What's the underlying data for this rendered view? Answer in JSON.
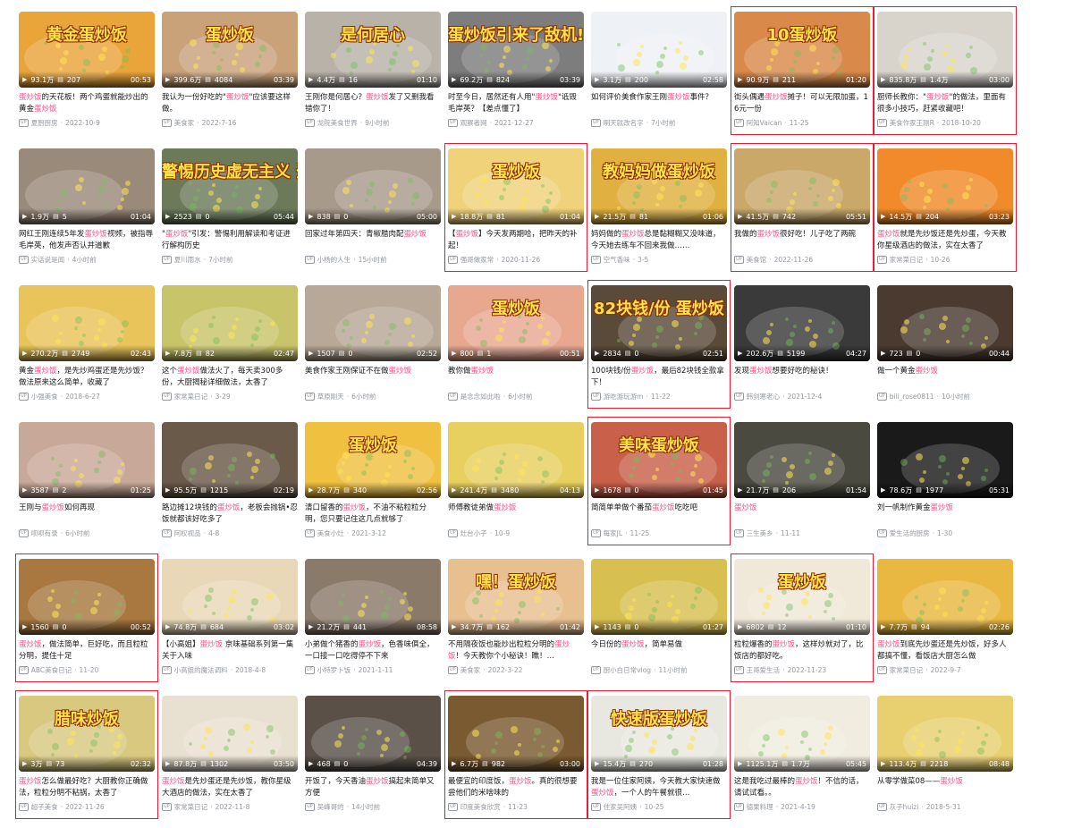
{
  "keyword": "蛋炒饭",
  "colors": {
    "highlight": "#ff4f8b",
    "box": "#e0203a"
  },
  "videos": [
    {
      "overlay": "黄金蛋炒饭",
      "views": "93.1万",
      "danmaku": "207",
      "duration": "00:53",
      "title": "蛋炒饭的天花板！两个鸡蛋就能炒出的黄金蛋炒饭",
      "author": "夏厨厨房",
      "date": "2022-10-9",
      "bg": "#e9a43a",
      "boxed": false
    },
    {
      "overlay": "蛋炒饭",
      "views": "399.6万",
      "danmaku": "4084",
      "duration": "03:39",
      "title": "我认为一份好吃的\"蛋炒饭\"应该要这样做。",
      "author": "美食家",
      "date": "2022-7-16",
      "bg": "#c9a27a",
      "boxed": false
    },
    {
      "overlay": "是何居心",
      "views": "4.4万",
      "danmaku": "16",
      "duration": "01:10",
      "title": "王刚你是何居心？蛋炒饭发了又删我看错你了！",
      "author": "龙院美食世界",
      "date": "9小时前",
      "bg": "#b8b2a8",
      "boxed": false
    },
    {
      "overlay": "蛋炒饭引来了敌机!?",
      "views": "69.2万",
      "danmaku": "824",
      "duration": "03:39",
      "title": "时至今日，居然还有人用\"蛋炒饭\"诋毁毛岸英？【差点懂了】",
      "author": "观察者网",
      "date": "2021-12-27",
      "bg": "#7d7d7d",
      "boxed": false
    },
    {
      "overlay": "",
      "views": "3.1万",
      "danmaku": "200",
      "duration": "02:58",
      "title": "如何评价美食作家王刚蛋炒饭事件？",
      "author": "明天就改名字",
      "date": "7小时前",
      "bg": "#eef1f5",
      "boxed": false
    },
    {
      "overlay": "10蛋炒饭",
      "views": "90.9万",
      "danmaku": "211",
      "duration": "01:20",
      "title": "街头偶遇蛋炒饭摊子！可以无限加蛋，16元一份",
      "author": "阿知Vaican",
      "date": "11-25",
      "bg": "#d9894a",
      "boxed": true
    },
    {
      "overlay": "",
      "views": "835.8万",
      "danmaku": "1.4万",
      "duration": "03:00",
      "title": "厨师长教你：\"蛋炒饭\"的做法，里面有很多小技巧，赶紧收藏吧！",
      "author": "美食作家王刚R",
      "date": "2018-10-20",
      "bg": "#d8d4cc",
      "boxed": true
    },
    {
      "overlay": "",
      "views": "1.9万",
      "danmaku": "5",
      "duration": "01:04",
      "title": "网红王刚连续5年发蛋炒饭视频，被指辱毛岸英，他发声否认并道歉",
      "author": "实话说是闻",
      "date": "4小时前",
      "bg": "#9a8a7a",
      "boxed": false
    },
    {
      "overlay": "警惕历史虚无主义 蛋炒饭诋毁烈士",
      "views": "2523",
      "danmaku": "0",
      "duration": "05:44",
      "title": "\"蛋炒饭\"引发：警惕利用解读和考证进行解构历史",
      "author": "夏川雨水",
      "date": "7小时前",
      "bg": "#6c7a5a",
      "boxed": false
    },
    {
      "overlay": "",
      "views": "838",
      "danmaku": "0",
      "duration": "05:00",
      "title": "回家过年第四天：青椒腊肉配蛋炒饭",
      "author": "小杨的人生",
      "date": "15小时前",
      "bg": "#a89a8a",
      "boxed": false
    },
    {
      "overlay": "蛋炒饭",
      "views": "18.8万",
      "danmaku": "81",
      "duration": "01:04",
      "title": "【蛋炒饭】今天发两期哈，把昨天的补起！",
      "author": "强哥做家常",
      "date": "2020-11-26",
      "bg": "#f0d27a",
      "boxed": true
    },
    {
      "overlay": "教妈妈做蛋炒饭",
      "views": "21.5万",
      "danmaku": "81",
      "duration": "01:06",
      "title": "妈妈做的蛋炒饭总是黏糊糊又没味道，今天她去练车不回来我做……",
      "author": "空气香味",
      "date": "3-5",
      "bg": "#e0b040",
      "boxed": false
    },
    {
      "overlay": "",
      "views": "41.5万",
      "danmaku": "742",
      "duration": "05:51",
      "title": "我做的蛋炒饭很好吃！儿子吃了两碗",
      "author": "美食馆",
      "date": "2022-11-26",
      "bg": "#c9a86a",
      "boxed": true
    },
    {
      "overlay": "",
      "views": "14.5万",
      "danmaku": "204",
      "duration": "03:23",
      "title": "蛋炒饭就是先炒饭还是先炒蛋，今天教你星级酒店的做法，实在太香了",
      "author": "家常菜日记",
      "date": "10-26",
      "bg": "#f08a2a",
      "boxed": true
    },
    {
      "overlay": "",
      "views": "270.2万",
      "danmaku": "2749",
      "duration": "02:43",
      "title": "黄金蛋炒饭，是先炒鸡蛋还是先炒饭？做法原来这么简单，收藏了",
      "author": "小强美食",
      "date": "2018-6-27",
      "bg": "#e9c45a",
      "boxed": false
    },
    {
      "overlay": "",
      "views": "7.8万",
      "danmaku": "82",
      "duration": "02:47",
      "title": "这个蛋炒饭做法火了，每天卖300多份，大厨揭秘详细做法，太香了",
      "author": "家常菜日记",
      "date": "3-29",
      "bg": "#c8c46a",
      "boxed": false
    },
    {
      "overlay": "",
      "views": "1507",
      "danmaku": "0",
      "duration": "02:52",
      "title": "美食作家王刚保证不在做蛋炒饭",
      "author": "草原刚天",
      "date": "6小时前",
      "bg": "#b8a898",
      "boxed": false
    },
    {
      "overlay": "蛋炒饭",
      "views": "800",
      "danmaku": "1",
      "duration": "00:51",
      "title": "教你做蛋炒饭",
      "author": "是念念如此啦",
      "date": "6小时前",
      "bg": "#e8a890",
      "boxed": false
    },
    {
      "overlay": "82块钱/份 蛋炒饭",
      "views": "2834",
      "danmaku": "0",
      "duration": "02:51",
      "title": "100块钱/份蛋炒饭，最后82块钱全款拿下！",
      "author": "游吃游玩游m",
      "date": "11-22",
      "bg": "#5a4a3a",
      "boxed": true
    },
    {
      "overlay": "",
      "views": "202.6万",
      "danmaku": "5199",
      "duration": "04:27",
      "title": "发现蛋炒饭想要好吃的秘诀！",
      "author": "韩剑寒老心",
      "date": "2021-12-4",
      "bg": "#3a3a3a",
      "boxed": false
    },
    {
      "overlay": "",
      "views": "723",
      "danmaku": "0",
      "duration": "00:44",
      "title": "做一个黄金蛋炒饭",
      "author": "bili_rose0811",
      "date": "10小时前",
      "bg": "#4a3a30",
      "boxed": false
    },
    {
      "overlay": "",
      "views": "3587",
      "danmaku": "2",
      "duration": "01:25",
      "title": "王刚与蛋炒饭如何再现",
      "author": "呗呗有录",
      "date": "6小时前",
      "bg": "#c8a898",
      "boxed": false
    },
    {
      "overlay": "",
      "views": "95.5万",
      "danmaku": "1215",
      "duration": "02:19",
      "title": "路边摊12块钱的蛋炒饭，老板会抛锅•忍饭就都该好吃多了",
      "author": "阿权视品",
      "date": "4-8",
      "bg": "#6a5a4a",
      "boxed": false
    },
    {
      "overlay": "蛋炒饭",
      "views": "28.7万",
      "danmaku": "340",
      "duration": "02:56",
      "title": "清口留香的蛋炒饭，不油不粘粒粒分明，您只要记住这几点就够了",
      "author": "美食小灶",
      "date": "2021-3-12",
      "bg": "#f0c040",
      "boxed": false
    },
    {
      "overlay": "",
      "views": "241.4万",
      "danmaku": "3480",
      "duration": "04:13",
      "title": "师傅教徒弟做蛋炒饭",
      "author": "灶台小子",
      "date": "10-9",
      "bg": "#e8d060",
      "boxed": false
    },
    {
      "overlay": "美味蛋炒饭",
      "views": "1678",
      "danmaku": "0",
      "duration": "01:45",
      "title": "简简单单做个番茄蛋炒饭吃吃吧",
      "author": "每家JL",
      "date": "11-25",
      "bg": "#c8604a",
      "boxed": true
    },
    {
      "overlay": "",
      "views": "21.7万",
      "danmaku": "206",
      "duration": "01:54",
      "title": "蛋炒饭",
      "author": "三生美乡",
      "date": "11-11",
      "bg": "#4a4a40",
      "boxed": false
    },
    {
      "overlay": "",
      "views": "78.6万",
      "danmaku": "1977",
      "duration": "05:31",
      "title": "刘一帆制作黄金蛋炒饭",
      "author": "爱生活的厨房",
      "date": "1-30",
      "bg": "#1a1a1a",
      "boxed": false
    },
    {
      "overlay": "",
      "views": "1560",
      "danmaku": "0",
      "duration": "00:52",
      "title": "蛋炒饭，做法简单，巨好吃，而且粒粒分明，提住十足",
      "author": "ABC美食日记",
      "date": "11-20",
      "bg": "#a87840",
      "boxed": true
    },
    {
      "overlay": "",
      "views": "74.8万",
      "danmaku": "684",
      "duration": "03:02",
      "title": "【小高姐】蛋炒饭 京味基础系列第一集 关于入味",
      "author": "小高姐的魔法调料",
      "date": "2018-4-8",
      "bg": "#e8d8b8",
      "boxed": false
    },
    {
      "overlay": "",
      "views": "21.2万",
      "danmaku": "441",
      "duration": "08:58",
      "title": "小弟做个猪香的蛋炒饭，色香味俱全，一口接一口吃得停不下来",
      "author": "小特罗卜饭",
      "date": "2021-1-11",
      "bg": "#8a7a6a",
      "boxed": false
    },
    {
      "overlay": "嘿！蛋炒饭",
      "views": "34.7万",
      "danmaku": "162",
      "duration": "01:42",
      "title": "不用隔夜饭也能炒出粒粒分明的蛋炒饭！今天教你个小秘诀！瞧！…",
      "author": "美食家",
      "date": "2022-3-22",
      "bg": "#e8c090",
      "boxed": false
    },
    {
      "overlay": "",
      "views": "1143",
      "danmaku": "0",
      "duration": "01:27",
      "title": "今日份的蛋炒饭，简单易做",
      "author": "厨小白日常vlog",
      "date": "11小时前",
      "bg": "#d8c050",
      "boxed": false
    },
    {
      "overlay": "蛋炒饭",
      "views": "6802",
      "danmaku": "12",
      "duration": "01:10",
      "title": "粒粒爆香的蛋炒饭，这样炒就对了，比饭店的都好吃。",
      "author": "王哥爱生活",
      "date": "2022-11-23",
      "bg": "#f0e8d8",
      "boxed": true
    },
    {
      "overlay": "",
      "views": "7.7万",
      "danmaku": "94",
      "duration": "02:26",
      "title": "蛋炒饭到底先炒蛋还是先炒饭，好多人都搞不懂，看饭店大厨怎么做",
      "author": "家常菜日记",
      "date": "2022-9-7",
      "bg": "#e8b840",
      "boxed": false
    },
    {
      "overlay": "腊味炒饭",
      "views": "3万",
      "danmaku": "73",
      "duration": "02:32",
      "title": "蛋炒饭怎么做最好吃？大厨教你正确做法，粒粒分明不粘锅，太香了",
      "author": "超子美食",
      "date": "2022-11-26",
      "bg": "#d8c880",
      "boxed": true
    },
    {
      "overlay": "",
      "views": "87.8万",
      "danmaku": "1302",
      "duration": "03:50",
      "title": "蛋炒饭是先炒蛋还是先炒饭，教你星级大酒店的做法，实在太香了",
      "author": "家常菜日记",
      "date": "2022-11-8",
      "bg": "#e8e0d0",
      "boxed": false
    },
    {
      "overlay": "",
      "views": "468",
      "danmaku": "0",
      "duration": "04:39",
      "title": "开饭了，今天香油蛋炒饭搞起来简单又方便",
      "author": "吴峰哥的",
      "date": "14小时前",
      "bg": "#5a5048",
      "boxed": false
    },
    {
      "overlay": "",
      "views": "6.7万",
      "danmaku": "982",
      "duration": "03:00",
      "title": "最便宜的印度饭，蛋炒饭。真的很想要尝他们的米啥味的",
      "author": "印度美食欣赏",
      "date": "11-23",
      "bg": "#7a5a30",
      "boxed": true
    },
    {
      "overlay": "快速版蛋炒饭",
      "views": "15.4万",
      "danmaku": "270",
      "duration": "01:28",
      "title": "我是一位住家阿姨，今天教大家快速做蛋炒饭，一个人的午餐就很…",
      "author": "住家吴阿姨",
      "date": "10-25",
      "bg": "#e8e8e0",
      "boxed": true
    },
    {
      "overlay": "",
      "views": "1125.1万",
      "danmaku": "1.7万",
      "duration": "05:45",
      "title": "这是我吃过最棒的蛋炒饭！不信的话，请试试看。。",
      "author": "德果料理",
      "date": "2021-4-19",
      "bg": "#f0ece0",
      "boxed": false
    },
    {
      "overlay": "",
      "views": "113.4万",
      "danmaku": "2218",
      "duration": "08:48",
      "title": "从零学做菜08——蛋炒饭",
      "author": "灰子huizi",
      "date": "2018-5-31",
      "bg": "#e8d070",
      "boxed": false
    }
  ]
}
